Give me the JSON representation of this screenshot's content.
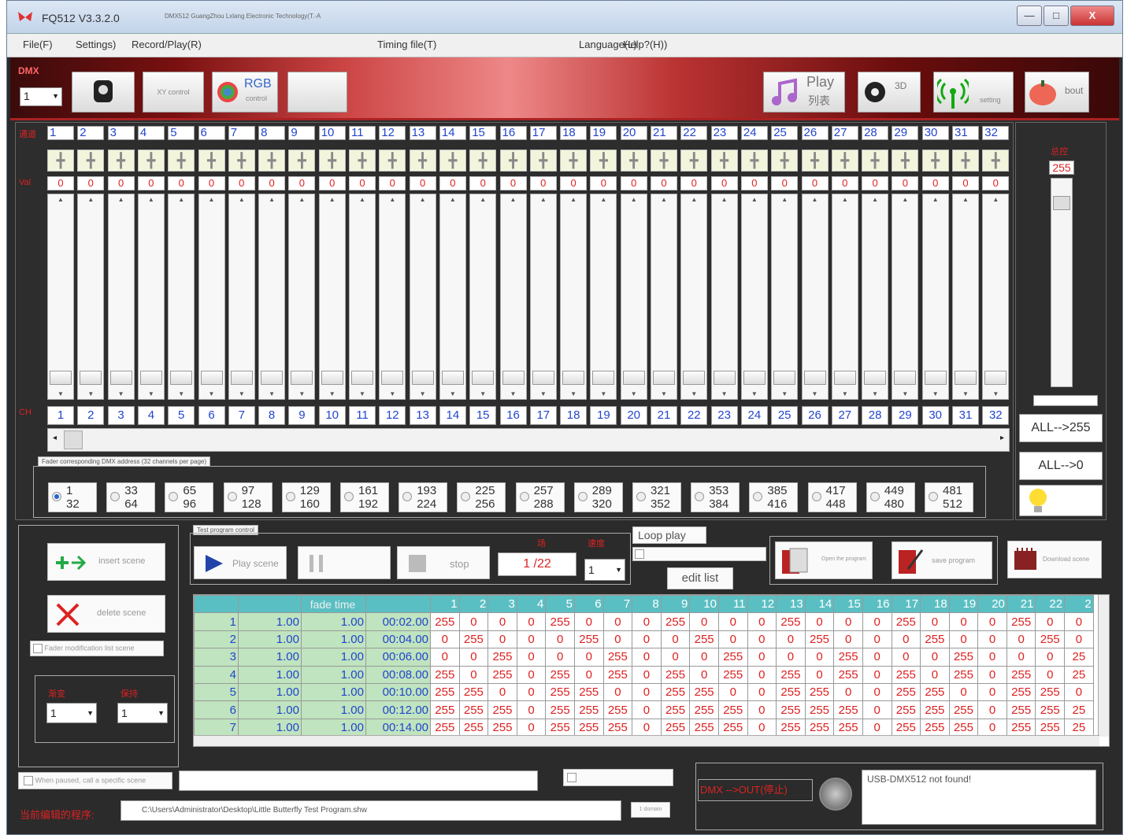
{
  "window": {
    "title": "FQ512 V3.3.2.0",
    "subtitle": "DMX512 GuangZhou Lxlang Electronic Technology(T.-A",
    "min": "—",
    "max": "□",
    "close": "X"
  },
  "menu": [
    {
      "label": "File(F)"
    },
    {
      "label": "Settings)"
    },
    {
      "label": "Record/Play(R)"
    },
    {
      "label": "Timing file(T)"
    },
    {
      "label": "Language(L)"
    },
    {
      "label": "Help?(H))"
    }
  ],
  "toolbar": {
    "device_value": "1",
    "xy_label": "XY control",
    "rgb_label": "RGB",
    "rgb_sub": "control",
    "play_label": "Play",
    "play_sub": "列表",
    "threed_label": "3D",
    "wireless_label": "setting",
    "about_label": "bout"
  },
  "faders": {
    "channels": [
      "1",
      "2",
      "3",
      "4",
      "5",
      "6",
      "7",
      "8",
      "9",
      "10",
      "11",
      "12",
      "13",
      "14",
      "15",
      "16",
      "17",
      "18",
      "19",
      "20",
      "21",
      "22",
      "23",
      "24",
      "25",
      "26",
      "27",
      "28",
      "29",
      "30",
      "31",
      "32"
    ],
    "values": [
      "0",
      "0",
      "0",
      "0",
      "0",
      "0",
      "0",
      "0",
      "0",
      "0",
      "0",
      "0",
      "0",
      "0",
      "0",
      "0",
      "0",
      "0",
      "0",
      "0",
      "0",
      "0",
      "0",
      "0",
      "0",
      "0",
      "0",
      "0",
      "0",
      "0",
      "0",
      "0"
    ],
    "addresses": [
      "1",
      "2",
      "3",
      "4",
      "5",
      "6",
      "7",
      "8",
      "9",
      "10",
      "11",
      "12",
      "13",
      "14",
      "15",
      "16",
      "17",
      "18",
      "19",
      "20",
      "21",
      "22",
      "23",
      "24",
      "25",
      "26",
      "27",
      "28",
      "29",
      "30",
      "31",
      "32"
    ]
  },
  "group_label": "Fader corresponding DMX address (32 channels per page)",
  "groups": [
    {
      "a": "1",
      "b": "32"
    },
    {
      "a": "33",
      "b": "64"
    },
    {
      "a": "65",
      "b": "96"
    },
    {
      "a": "97",
      "b": "128"
    },
    {
      "a": "129",
      "b": "160"
    },
    {
      "a": "161",
      "b": "192"
    },
    {
      "a": "193",
      "b": "224"
    },
    {
      "a": "225",
      "b": "256"
    },
    {
      "a": "257",
      "b": "288"
    },
    {
      "a": "289",
      "b": "320"
    },
    {
      "a": "321",
      "b": "352"
    },
    {
      "a": "353",
      "b": "384"
    },
    {
      "a": "385",
      "b": "416"
    },
    {
      "a": "417",
      "b": "448"
    },
    {
      "a": "449",
      "b": "480"
    },
    {
      "a": "481",
      "b": "512"
    }
  ],
  "master": {
    "value": "255",
    "all_on": "ALL-->255",
    "all_off": "ALL-->0"
  },
  "scene": {
    "insert": "insert scene",
    "delete": "delete scene",
    "fader_mod": "Fader modification list scene"
  },
  "program": {
    "label": "Test program control",
    "play": "Play scene",
    "stop": "stop",
    "counter": "1 /22",
    "speed": "1",
    "loop": "Loop play",
    "edit": "edit list",
    "open": "Open the program",
    "save": "save program",
    "download": "Download scene"
  },
  "table": {
    "h_fade_time": "fade time",
    "cols": [
      "1",
      "2",
      "3",
      "4",
      "5",
      "6",
      "7",
      "8",
      "9",
      "10",
      "11",
      "12",
      "13",
      "14",
      "15",
      "16",
      "17",
      "18",
      "19",
      "20",
      "21",
      "22",
      "2"
    ],
    "rows": [
      {
        "n": "1",
        "d": "1.00",
        "f": "1.00",
        "t": "00:02.00",
        "v": [
          "255",
          "0",
          "0",
          "0",
          "255",
          "0",
          "0",
          "0",
          "255",
          "0",
          "0",
          "0",
          "255",
          "0",
          "0",
          "0",
          "255",
          "0",
          "0",
          "0",
          "255",
          "0",
          "0"
        ]
      },
      {
        "n": "2",
        "d": "1.00",
        "f": "1.00",
        "t": "00:04.00",
        "v": [
          "0",
          "255",
          "0",
          "0",
          "0",
          "255",
          "0",
          "0",
          "0",
          "255",
          "0",
          "0",
          "0",
          "255",
          "0",
          "0",
          "0",
          "255",
          "0",
          "0",
          "0",
          "255",
          "0"
        ]
      },
      {
        "n": "3",
        "d": "1.00",
        "f": "1.00",
        "t": "00:06.00",
        "v": [
          "0",
          "0",
          "255",
          "0",
          "0",
          "0",
          "255",
          "0",
          "0",
          "0",
          "255",
          "0",
          "0",
          "0",
          "255",
          "0",
          "0",
          "0",
          "255",
          "0",
          "0",
          "0",
          "25"
        ]
      },
      {
        "n": "4",
        "d": "1.00",
        "f": "1.00",
        "t": "00:08.00",
        "v": [
          "255",
          "0",
          "255",
          "0",
          "255",
          "0",
          "255",
          "0",
          "255",
          "0",
          "255",
          "0",
          "255",
          "0",
          "255",
          "0",
          "255",
          "0",
          "255",
          "0",
          "255",
          "0",
          "25"
        ]
      },
      {
        "n": "5",
        "d": "1.00",
        "f": "1.00",
        "t": "00:10.00",
        "v": [
          "255",
          "255",
          "0",
          "0",
          "255",
          "255",
          "0",
          "0",
          "255",
          "255",
          "0",
          "0",
          "255",
          "255",
          "0",
          "0",
          "255",
          "255",
          "0",
          "0",
          "255",
          "255",
          "0"
        ]
      },
      {
        "n": "6",
        "d": "1.00",
        "f": "1.00",
        "t": "00:12.00",
        "v": [
          "255",
          "255",
          "255",
          "0",
          "255",
          "255",
          "255",
          "0",
          "255",
          "255",
          "255",
          "0",
          "255",
          "255",
          "255",
          "0",
          "255",
          "255",
          "255",
          "0",
          "255",
          "255",
          "25"
        ]
      },
      {
        "n": "7",
        "d": "1.00",
        "f": "1.00",
        "t": "00:14.00",
        "v": [
          "255",
          "255",
          "255",
          "0",
          "255",
          "255",
          "255",
          "0",
          "255",
          "255",
          "255",
          "0",
          "255",
          "255",
          "255",
          "0",
          "255",
          "255",
          "255",
          "0",
          "255",
          "255",
          "25"
        ]
      }
    ]
  },
  "left": {
    "sel1": "1",
    "sel2": "1"
  },
  "bottom": {
    "paused": "When paused, call a specific scene",
    "path": "C:\\Users\\Administrator\\Desktop\\Little Butterfly Test Program.shw",
    "status": "USB-DMX512 not found!",
    "dmx_out": "DMX -->OUT(停止)",
    "domain": "1 domain"
  },
  "colors": {
    "accent": "#d22",
    "blue": "#24c",
    "header": "#5abfc3",
    "green": "#bfe4bf"
  }
}
